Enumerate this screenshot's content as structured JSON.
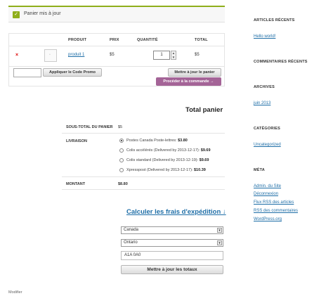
{
  "notice": {
    "message": "Panier mis à jour",
    "check": "✓"
  },
  "cart": {
    "headers": {
      "product": "PRODUIT",
      "price": "PRIX",
      "quantity": "QUANTITÉ",
      "total": "TOTAL"
    },
    "item": {
      "remove": "×",
      "name": "produit 1",
      "price": "$5",
      "quantity": "1",
      "total": "$5"
    },
    "coupon_button": "Appliquer le Code Promo",
    "update_button": "Mettre à jour le panier",
    "checkout_button": "Procéder à la commande →"
  },
  "totals": {
    "title": "Total panier",
    "subtotal_label": "SOUS-TOTAL DU PANIER",
    "subtotal_value": "$5",
    "shipping_label": "LIVRAISON",
    "shipping_options": [
      {
        "text": "Postes Canada Poste-lettres: ",
        "price": "$3.80",
        "selected": true
      },
      {
        "text": "Colis accélérés (Delivered by 2013-12-17): ",
        "price": "$9.69",
        "selected": false
      },
      {
        "text": "Colis standard (Delivered by 2013-12-19): ",
        "price": "$9.69",
        "selected": false
      },
      {
        "text": "Xpresspost (Delivered by 2013-12-17): ",
        "price": "$10.39",
        "selected": false
      }
    ],
    "amount_label": "MONTANT",
    "amount_value": "$8.80"
  },
  "shipping_calc": {
    "title": "Calculer les frais d'expédition ↓",
    "country": "Canada",
    "province": "Ontario",
    "postal_code": "A1A 0A0",
    "update_button": "Mettre à jour les totaux"
  },
  "footer": {
    "edit": "Modifier"
  },
  "sidebar": {
    "recent_posts_title": "ARTICLES RÉCENTS",
    "recent_posts": [
      "Hello world!"
    ],
    "recent_comments_title": "COMMENTAIRES RÉCENTS",
    "archives_title": "ARCHIVES",
    "archives": [
      "juin 2013"
    ],
    "categories_title": "CATÉGORIES",
    "categories": [
      "Uncategorized"
    ],
    "meta_title": "MÉTA",
    "meta": [
      "Admin. du Site",
      "Déconnexion",
      "Flux RSS des articles",
      "RSS des commentaires",
      "WordPress.org"
    ]
  },
  "colors": {
    "accent_green": "#8fae1b",
    "checkout_purple": "#a46497",
    "link_blue": "#1e6ea7",
    "remove_red": "#dd0000"
  }
}
